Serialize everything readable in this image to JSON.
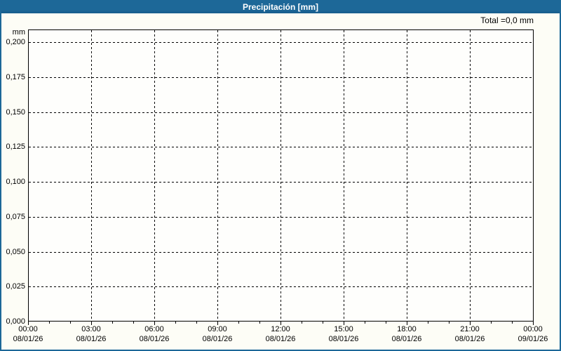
{
  "window": {
    "title": "Precipitación [mm]"
  },
  "colors": {
    "titlebar_bg": "#1d6898",
    "titlebar_bg2": "#175d8c",
    "titlebar_text": "#ffffff",
    "window_border": "#1d6898",
    "background": "#fdfdf6",
    "plot_bg": "#fefefc",
    "grid_line": "#000000",
    "axis_line": "#000000",
    "text": "#000000"
  },
  "chart_data": {
    "type": "bar",
    "title": "Precipitación [mm]",
    "total_label": "Total =0,0 mm",
    "grid": true,
    "legend": false,
    "y_axis": {
      "unit": "mm",
      "min": 0,
      "max": 0.2,
      "tick_step": 0.025,
      "ticks": [
        {
          "value": 0.2,
          "label": "0,200"
        },
        {
          "value": 0.175,
          "label": "0,175"
        },
        {
          "value": 0.15,
          "label": "0,150"
        },
        {
          "value": 0.125,
          "label": "0,125"
        },
        {
          "value": 0.1,
          "label": "0,100"
        },
        {
          "value": 0.075,
          "label": "0,075"
        },
        {
          "value": 0.05,
          "label": "0,050"
        },
        {
          "value": 0.025,
          "label": "0,025"
        },
        {
          "value": 0.0,
          "label": "0,000"
        }
      ]
    },
    "x_axis": {
      "span_hours": 24,
      "minor_tick_hours": 1,
      "major_tick_hours": 3,
      "ticks": [
        {
          "hour": 0,
          "time": "00:00",
          "date": "08/01/26"
        },
        {
          "hour": 3,
          "time": "03:00",
          "date": "08/01/26"
        },
        {
          "hour": 6,
          "time": "06:00",
          "date": "08/01/26"
        },
        {
          "hour": 9,
          "time": "09:00",
          "date": "08/01/26"
        },
        {
          "hour": 12,
          "time": "12:00",
          "date": "08/01/26"
        },
        {
          "hour": 15,
          "time": "15:00",
          "date": "08/01/26"
        },
        {
          "hour": 18,
          "time": "18:00",
          "date": "08/01/26"
        },
        {
          "hour": 21,
          "time": "21:00",
          "date": "08/01/26"
        },
        {
          "hour": 24,
          "time": "00:00",
          "date": "09/01/26"
        }
      ]
    },
    "series": [
      {
        "name": "Precipitación",
        "values": []
      }
    ]
  }
}
